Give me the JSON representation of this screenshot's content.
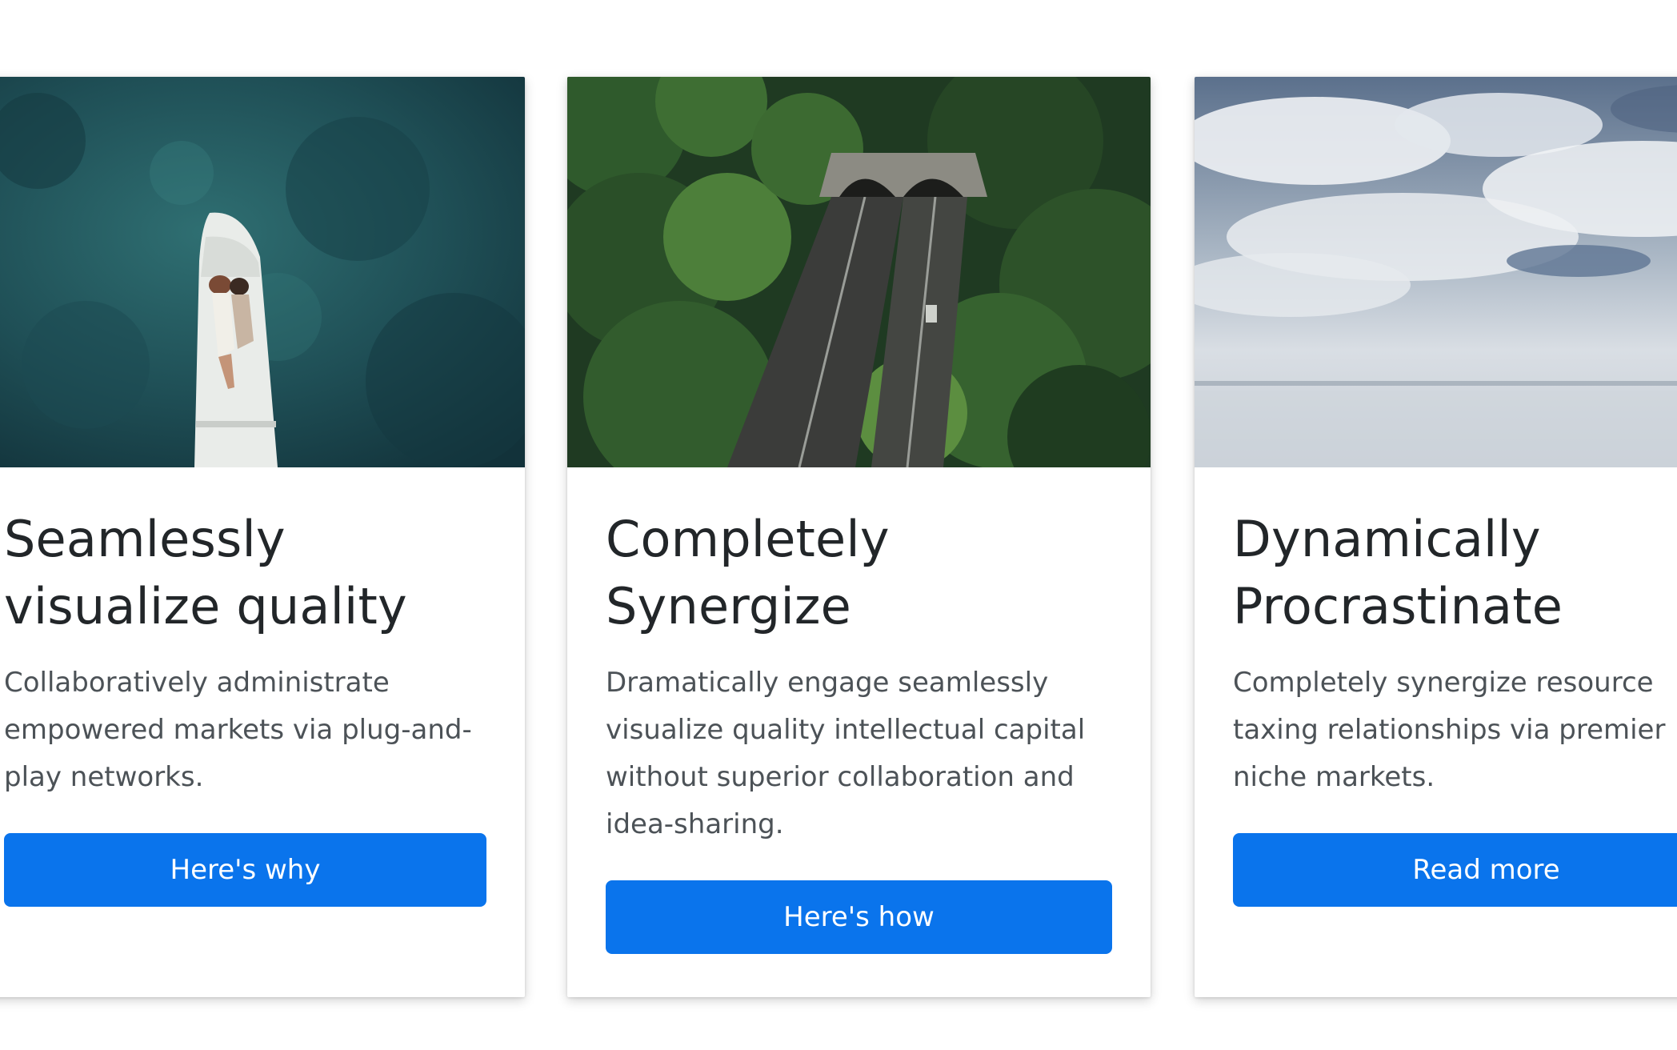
{
  "cards": [
    {
      "title": "Seamlessly visualize quality",
      "text": "Collaboratively administrate empowered markets via plug-and-play networks.",
      "button": "Here's why",
      "image": "aerial ocean boat with couple"
    },
    {
      "title": "Completely Synergize",
      "text": "Dramatically engage seamlessly visualize quality intellectual capital without superior collaboration and idea-sharing.",
      "button": "Here's how",
      "image": "aerial forest road tunnel"
    },
    {
      "title": "Dynamically Procrastinate",
      "text": "Completely synergize resource taxing relationships via premier niche markets.",
      "button": "Read more",
      "image": "cloudy sky reflection"
    }
  ],
  "colors": {
    "button": "#0a74ec",
    "title": "#222629",
    "body_text": "#4c5257"
  }
}
